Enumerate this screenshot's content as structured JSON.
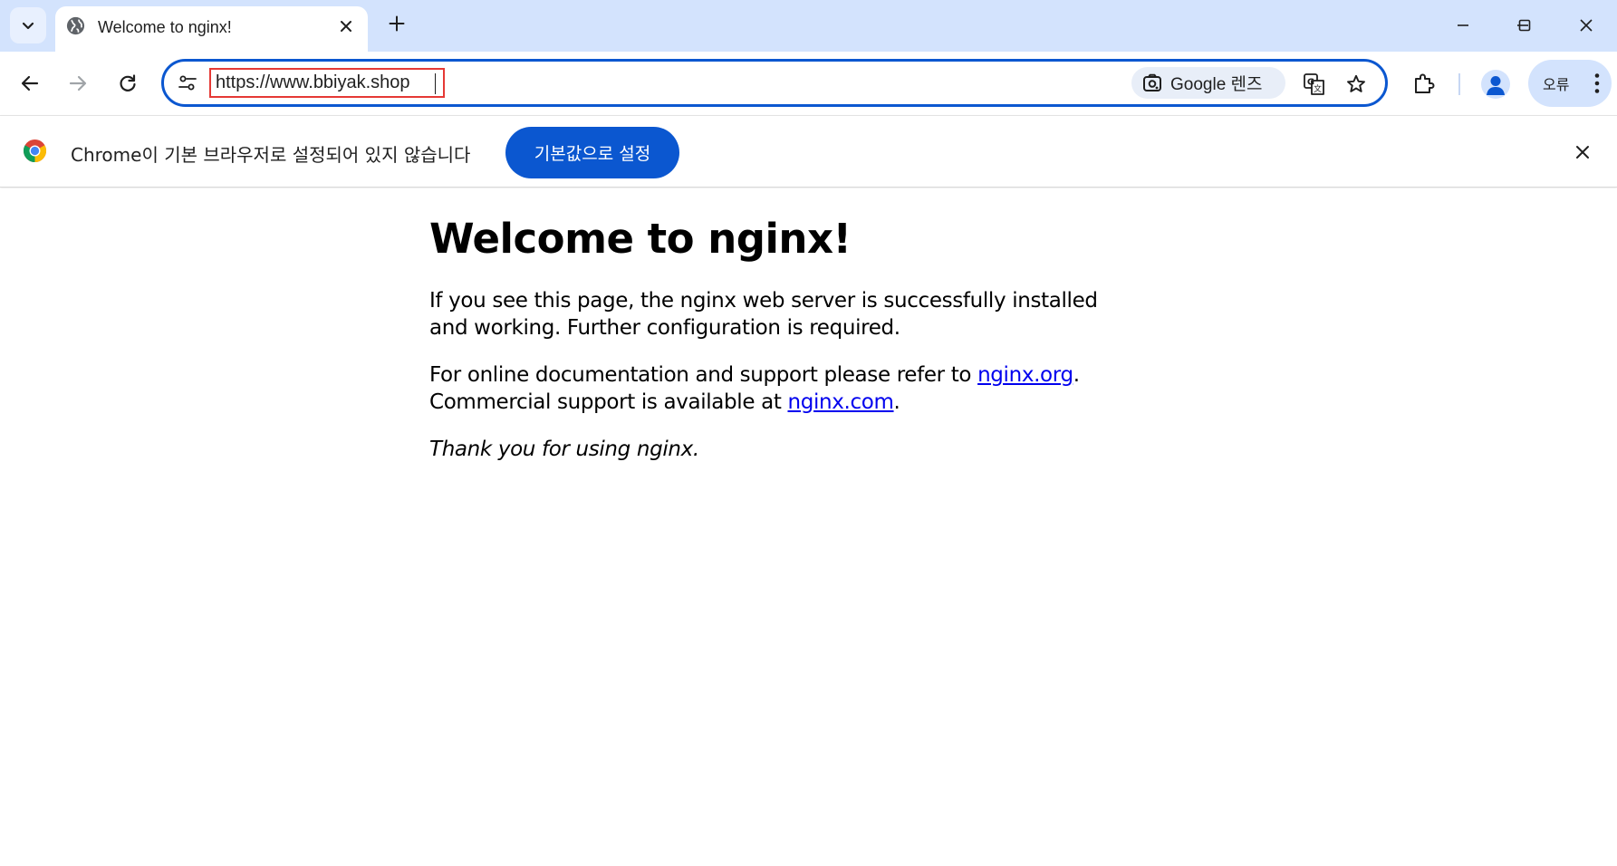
{
  "browser": {
    "tab": {
      "title": "Welcome to nginx!"
    },
    "omnibox": {
      "url": "https://www.bbiyak.shop"
    },
    "lens_chip": {
      "label": "Google 렌즈"
    },
    "profile_chip": {
      "label": "오류"
    }
  },
  "infobar": {
    "message": "Chrome이 기본 브라우저로 설정되어 있지 않습니다",
    "button_label": "기본값으로 설정"
  },
  "page": {
    "heading": "Welcome to nginx!",
    "para1": "If you see this page, the nginx web server is successfully installed and working. Further configuration is required.",
    "para2_prefix": "For online documentation and support please refer to ",
    "link_org": "nginx.org",
    "para2_middle": ".",
    "para2_line2_prefix": "Commercial support is available at ",
    "link_com": "nginx.com",
    "para2_suffix": ".",
    "thanks": "Thank you for using nginx."
  },
  "colors": {
    "tabstrip_bg": "#d3e3fd",
    "accent_blue": "#0b57d0",
    "url_highlight_border": "#e53935",
    "link_color": "#0000ee"
  }
}
